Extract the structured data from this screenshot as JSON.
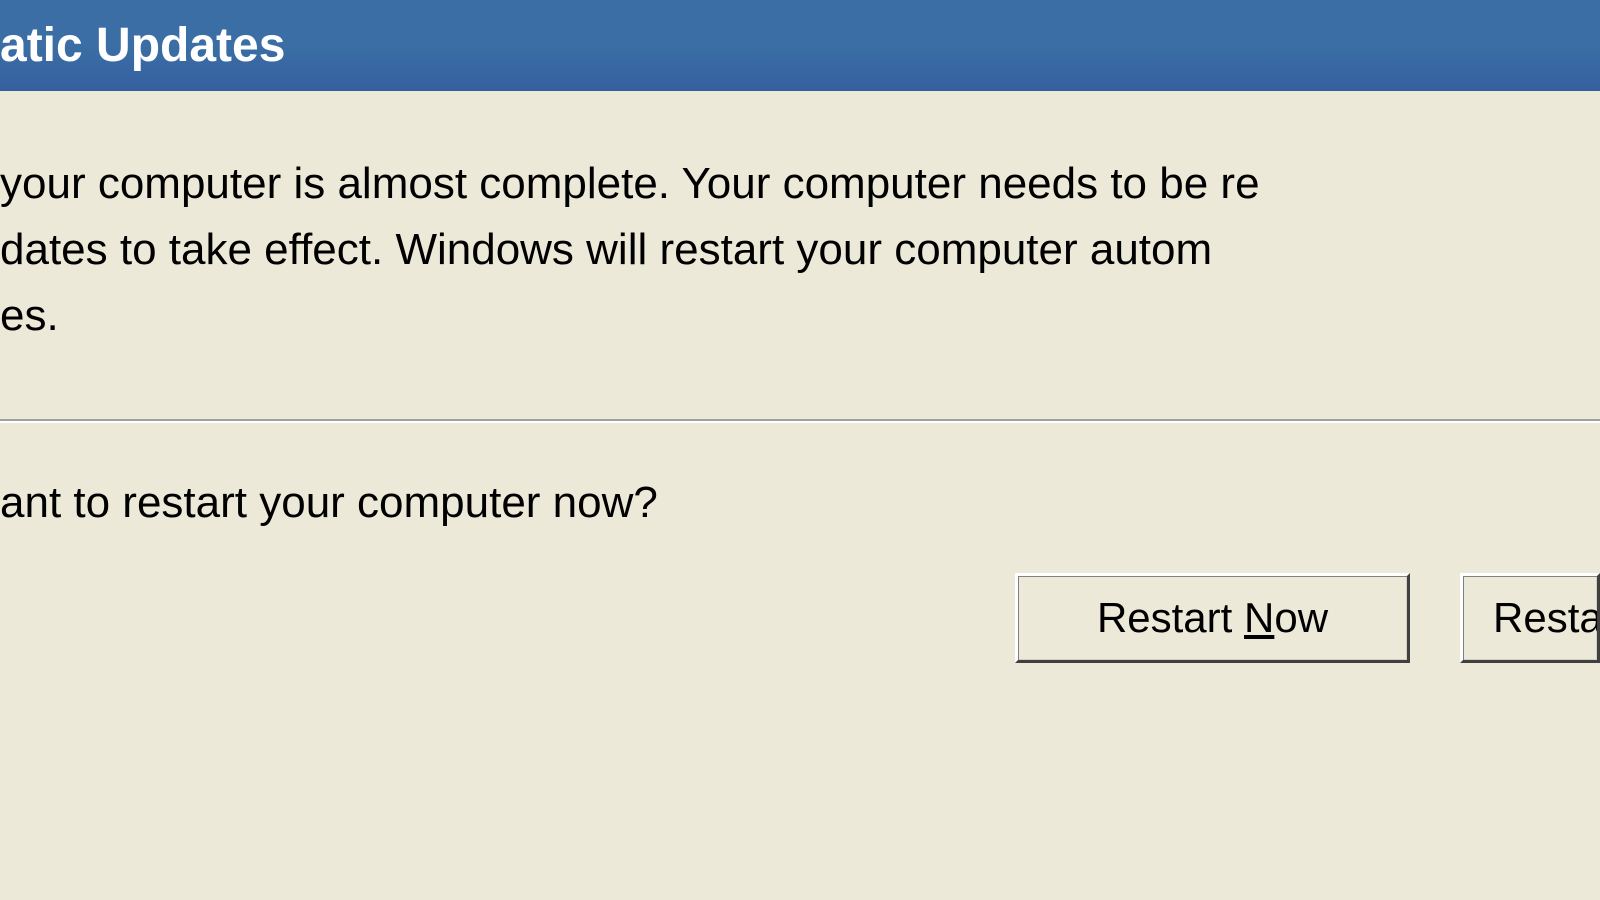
{
  "dialog": {
    "title_visible": "atic Updates",
    "message_line1": "your computer is almost complete. Your computer needs to be re",
    "message_line2": "dates to take effect. Windows will restart your computer autom",
    "message_line3": "es.",
    "question": "ant to restart your computer now?",
    "buttons": {
      "restart_now_pre": "Restart ",
      "restart_now_key": "N",
      "restart_now_post": "ow",
      "restart_later_visible": "Resta"
    }
  }
}
